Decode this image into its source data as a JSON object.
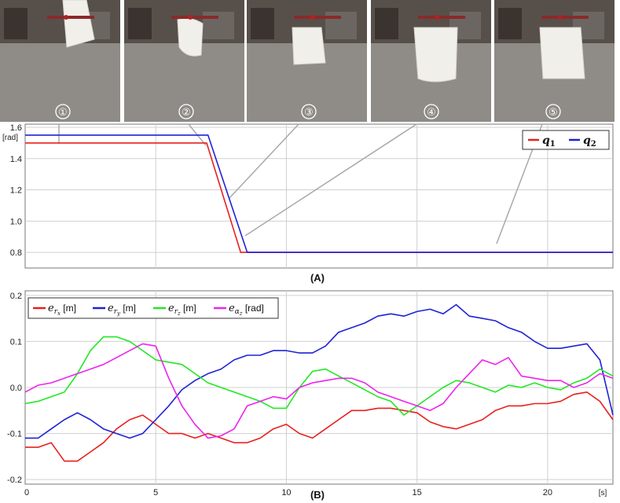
{
  "photos": [
    {
      "label": "①"
    },
    {
      "label": "②"
    },
    {
      "label": "③"
    },
    {
      "label": "④"
    },
    {
      "label": "⑤"
    }
  ],
  "colors": {
    "q1": "#e8201e",
    "q2": "#1f22d6",
    "er_x": "#e8201e",
    "er_y": "#1f22d6",
    "er_z": "#22e822",
    "e_alpha": "#ee22ee"
  },
  "chart_data": [
    {
      "id": "A",
      "type": "line",
      "caption": "(A)",
      "ylabel": "[rad]",
      "xlim": [
        0,
        22.5
      ],
      "ylim": [
        0.7,
        1.62
      ],
      "yticks": [
        0.8,
        1.0,
        1.2,
        1.4,
        1.6
      ],
      "ytick_labels": [
        "0.8",
        "1.0",
        "1.2",
        "1.4",
        "1.6"
      ],
      "xgrid": [
        5,
        10,
        15,
        20
      ],
      "grid": true,
      "legend": "top-right",
      "series": [
        {
          "name": "q1",
          "label_main": "q",
          "label_sub": "1",
          "x": [
            0,
            6.95,
            8.25,
            22.5
          ],
          "y": [
            1.5,
            1.5,
            0.8,
            0.8
          ]
        },
        {
          "name": "q2",
          "label_main": "q",
          "label_sub": "2",
          "x": [
            0,
            7.0,
            8.5,
            22.5
          ],
          "y": [
            1.55,
            1.55,
            0.8,
            0.8
          ]
        }
      ]
    },
    {
      "id": "B",
      "type": "line",
      "caption": "(B)",
      "xlabel": "[s]",
      "xlim": [
        0,
        22.5
      ],
      "ylim": [
        -0.21,
        0.21
      ],
      "xticks": [
        0,
        5,
        10,
        15,
        20
      ],
      "xtick_labels": [
        "0",
        "5",
        "10",
        "15",
        "20"
      ],
      "yticks": [
        -0.2,
        -0.1,
        0.0,
        0.1,
        0.2
      ],
      "ytick_labels": [
        "-0.2",
        "-0.1",
        "0.0",
        "0.1",
        "0.2"
      ],
      "grid": true,
      "legend": "top-left",
      "series": [
        {
          "name": "e_rx",
          "sym": "e",
          "sub": "r",
          "subsub": "x",
          "unit": "[m]",
          "x": [
            0,
            0.5,
            1.0,
            1.5,
            2.0,
            2.5,
            3.0,
            3.5,
            4.0,
            4.5,
            5.0,
            5.5,
            6.0,
            6.5,
            7.0,
            7.5,
            8.0,
            8.5,
            9.0,
            9.5,
            10.0,
            10.5,
            11.0,
            11.5,
            12.0,
            12.5,
            13.0,
            13.5,
            14.0,
            14.5,
            15.0,
            15.5,
            16.0,
            16.5,
            17.0,
            17.5,
            18.0,
            18.5,
            19.0,
            19.5,
            20.0,
            20.5,
            21.0,
            21.5,
            22.0,
            22.5
          ],
          "y": [
            -0.13,
            -0.13,
            -0.12,
            -0.16,
            -0.16,
            -0.14,
            -0.12,
            -0.09,
            -0.07,
            -0.06,
            -0.08,
            -0.1,
            -0.1,
            -0.11,
            -0.1,
            -0.11,
            -0.12,
            -0.12,
            -0.11,
            -0.09,
            -0.08,
            -0.1,
            -0.11,
            -0.09,
            -0.07,
            -0.05,
            -0.05,
            -0.045,
            -0.045,
            -0.05,
            -0.055,
            -0.075,
            -0.085,
            -0.09,
            -0.08,
            -0.07,
            -0.05,
            -0.04,
            -0.04,
            -0.035,
            -0.035,
            -0.03,
            -0.015,
            -0.01,
            -0.03,
            -0.07
          ]
        },
        {
          "name": "e_ry",
          "sym": "e",
          "sub": "r",
          "subsub": "y",
          "unit": "[m]",
          "x": [
            0,
            0.5,
            1.0,
            1.5,
            2.0,
            2.5,
            3.0,
            3.5,
            4.0,
            4.5,
            5.0,
            5.5,
            6.0,
            6.5,
            7.0,
            7.5,
            8.0,
            8.5,
            9.0,
            9.5,
            10.0,
            10.5,
            11.0,
            11.5,
            12.0,
            12.5,
            13.0,
            13.5,
            14.0,
            14.5,
            15.0,
            15.5,
            16.0,
            16.5,
            17.0,
            17.5,
            18.0,
            18.5,
            19.0,
            19.5,
            20.0,
            20.5,
            21.0,
            21.5,
            22.0,
            22.5
          ],
          "y": [
            -0.11,
            -0.11,
            -0.09,
            -0.07,
            -0.055,
            -0.07,
            -0.09,
            -0.1,
            -0.11,
            -0.1,
            -0.07,
            -0.04,
            -0.005,
            0.015,
            0.03,
            0.04,
            0.06,
            0.07,
            0.07,
            0.08,
            0.08,
            0.075,
            0.075,
            0.09,
            0.12,
            0.13,
            0.14,
            0.155,
            0.16,
            0.155,
            0.165,
            0.17,
            0.16,
            0.18,
            0.155,
            0.15,
            0.145,
            0.13,
            0.12,
            0.1,
            0.085,
            0.085,
            0.09,
            0.095,
            0.06,
            -0.06
          ]
        },
        {
          "name": "e_rz",
          "sym": "e",
          "sub": "r",
          "subsub": "z",
          "unit": "[m]",
          "x": [
            0,
            0.5,
            1.0,
            1.5,
            2.0,
            2.5,
            3.0,
            3.5,
            4.0,
            4.5,
            5.0,
            5.5,
            6.0,
            6.5,
            7.0,
            7.5,
            8.0,
            8.5,
            9.0,
            9.5,
            10.0,
            10.5,
            11.0,
            11.5,
            12.0,
            12.5,
            13.0,
            13.5,
            14.0,
            14.5,
            15.0,
            15.5,
            16.0,
            16.5,
            17.0,
            17.5,
            18.0,
            18.5,
            19.0,
            19.5,
            20.0,
            20.5,
            21.0,
            21.5,
            22.0,
            22.5
          ],
          "y": [
            -0.035,
            -0.03,
            -0.02,
            -0.01,
            0.03,
            0.08,
            0.11,
            0.11,
            0.1,
            0.08,
            0.06,
            0.055,
            0.05,
            0.03,
            0.01,
            0.0,
            -0.01,
            -0.02,
            -0.03,
            -0.045,
            -0.045,
            0.0,
            0.035,
            0.04,
            0.025,
            0.01,
            -0.005,
            -0.02,
            -0.03,
            -0.06,
            -0.04,
            -0.02,
            0.0,
            0.015,
            0.01,
            0.0,
            -0.01,
            0.005,
            0.0,
            0.01,
            0.0,
            -0.005,
            0.01,
            0.02,
            0.04,
            0.025
          ]
        },
        {
          "name": "e_alpha",
          "sym": "e",
          "sub": "α",
          "subsub": "z",
          "unit": "[rad]",
          "x": [
            0,
            0.5,
            1.0,
            1.5,
            2.0,
            2.5,
            3.0,
            3.5,
            4.0,
            4.5,
            5.0,
            5.5,
            6.0,
            6.5,
            7.0,
            7.5,
            8.0,
            8.5,
            9.0,
            9.5,
            10.0,
            10.5,
            11.0,
            11.5,
            12.0,
            12.5,
            13.0,
            13.5,
            14.0,
            14.5,
            15.0,
            15.5,
            16.0,
            16.5,
            17.0,
            17.5,
            18.0,
            18.5,
            19.0,
            19.5,
            20.0,
            20.5,
            21.0,
            21.5,
            22.0,
            22.5
          ],
          "y": [
            -0.01,
            0.005,
            0.01,
            0.02,
            0.03,
            0.04,
            0.05,
            0.065,
            0.08,
            0.095,
            0.09,
            0.02,
            -0.04,
            -0.08,
            -0.11,
            -0.105,
            -0.09,
            -0.04,
            -0.03,
            -0.02,
            -0.025,
            0.0,
            0.01,
            0.015,
            0.02,
            0.02,
            0.01,
            -0.01,
            -0.02,
            -0.03,
            -0.04,
            -0.05,
            -0.035,
            0.0,
            0.03,
            0.06,
            0.05,
            0.065,
            0.025,
            0.02,
            0.015,
            0.015,
            0.0,
            0.01,
            0.03,
            0.02
          ]
        }
      ]
    }
  ]
}
